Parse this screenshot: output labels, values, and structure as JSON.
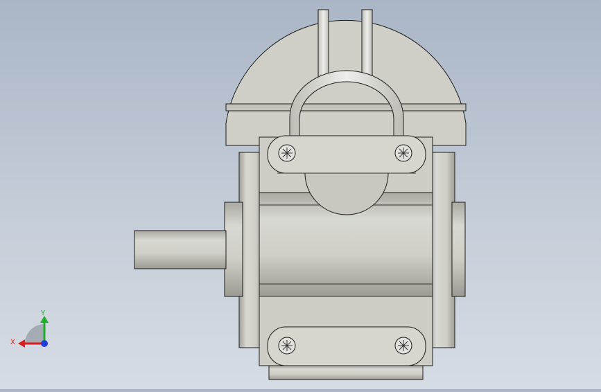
{
  "viewport": {
    "background_top": "#aab6c6",
    "background_bottom": "#d6dce4",
    "model_fill": "#cfcfc8",
    "model_shade": "#a9a9a2",
    "edge_color": "#1a1a1a"
  },
  "triad": {
    "x_label": "X",
    "y_label": "Y",
    "x_color": "#d81e1e",
    "y_color": "#1fae2c",
    "z_color": "#1f3fd8"
  }
}
